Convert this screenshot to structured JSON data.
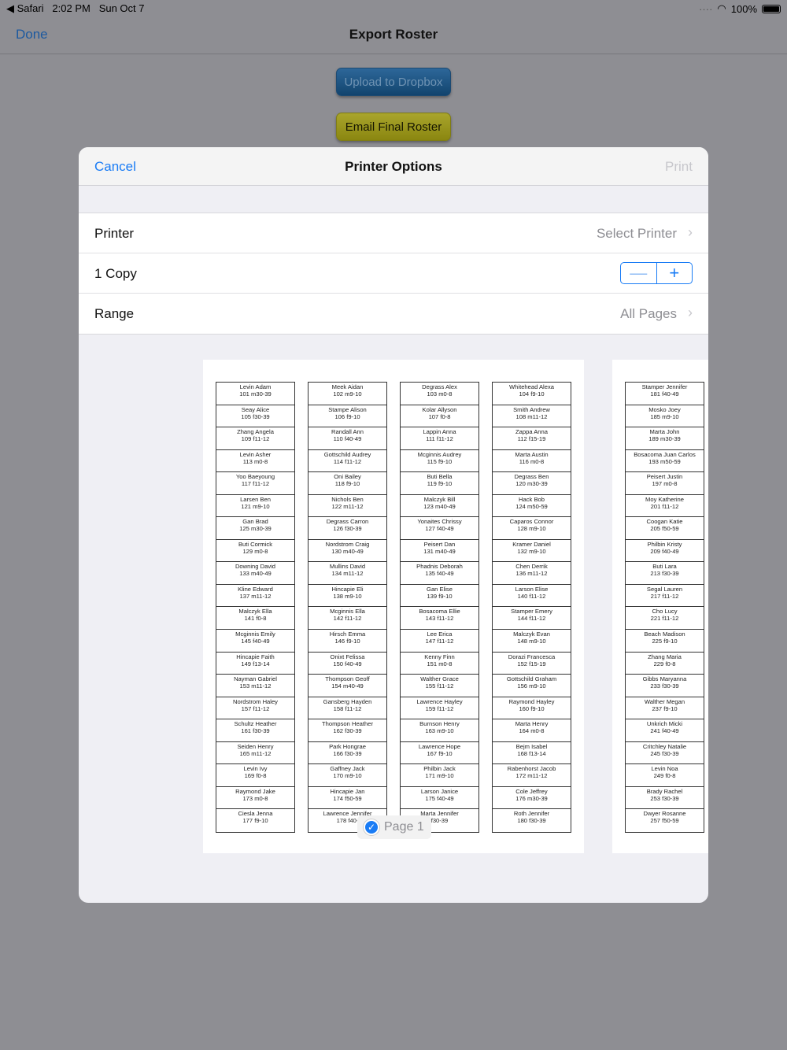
{
  "status": {
    "back_app": "Safari",
    "time": "2:02 PM",
    "date": "Sun Oct 7",
    "battery": "100%",
    "battery_level": 1.0
  },
  "nav": {
    "done": "Done",
    "title": "Export Roster"
  },
  "actions": {
    "upload": "Upload to Dropbox",
    "email": "Email Final Roster"
  },
  "printer_options": {
    "cancel": "Cancel",
    "title": "Printer Options",
    "print": "Print",
    "printer_label": "Printer",
    "printer_value": "Select Printer",
    "copies_label": "1 Copy",
    "copies": 1,
    "range_label": "Range",
    "range_value": "All Pages",
    "page_badge": "Page 1"
  },
  "pages": [
    {
      "columns": [
        {
          "cells": [
            [
              "Levin Adam",
              "101 m30-39"
            ],
            [
              "Seay Alice",
              "105 f30-39"
            ],
            [
              "Zhang Angela",
              "109 f11-12"
            ],
            [
              "Levin Asher",
              "113 m0-8"
            ],
            [
              "Yoo Baeyoung",
              "117 f11-12"
            ],
            [
              "Larsen Ben",
              "121 m9-10"
            ],
            [
              "Gan Brad",
              "125 m30-39"
            ],
            [
              "Buti Cormick",
              "129 m0-8"
            ],
            [
              "Downing David",
              "133 m40-49"
            ],
            [
              "Kline Edward",
              "137 m11-12"
            ],
            [
              "Malczyk Ella",
              "141 f0-8"
            ],
            [
              "Mcginnis Emily",
              "145 f40-49"
            ],
            [
              "Hincapie Faith",
              "149 f13-14"
            ],
            [
              "Nayman Gabriel",
              "153 m11-12"
            ],
            [
              "Nordstrom Haley",
              "157 f11-12"
            ],
            [
              "Schultz Heather",
              "161 f30-39"
            ],
            [
              "Seiden Henry",
              "165 m11-12"
            ],
            [
              "Levin Ivy",
              "169 f0-8"
            ],
            [
              "Raymond Jake",
              "173 m0-8"
            ],
            [
              "Ciesla Jenna",
              "177 f9-10"
            ]
          ]
        },
        {
          "cells": [
            [
              "Meek Aidan",
              "102 m9-10"
            ],
            [
              "Stampe Alison",
              "106 f9-10"
            ],
            [
              "Randall Ann",
              "110 f40-49"
            ],
            [
              "Gottschild Audrey",
              "114 f11-12"
            ],
            [
              "Oni Bailey",
              "118 f9-10"
            ],
            [
              "Nichols Ben",
              "122 m11-12"
            ],
            [
              "Degrass Carron",
              "126 f30-39"
            ],
            [
              "Nordstrom Craig",
              "130 m40-49"
            ],
            [
              "Mullins David",
              "134 m11-12"
            ],
            [
              "Hincapie Eli",
              "138 m9-10"
            ],
            [
              "Mcginnis Ella",
              "142 f11-12"
            ],
            [
              "Hirsch Emma",
              "146 f9-10"
            ],
            [
              "Onixt Felissa",
              "150 f40-49"
            ],
            [
              "Thompson Geoff",
              "154 m40-49"
            ],
            [
              "Gansberg Hayden",
              "158 f11-12"
            ],
            [
              "Thompson Heather",
              "162 f30-39"
            ],
            [
              "Park Hongrae",
              "166 f30-39"
            ],
            [
              "Gaffney Jack",
              "170 m9-10"
            ],
            [
              "Hincapie Jan",
              "174 f50-59"
            ],
            [
              "Lawrence Jennifer",
              "178 f40-"
            ]
          ]
        },
        {
          "cells": [
            [
              "Degrass Alex",
              "103 m0-8"
            ],
            [
              "Kolar Allyson",
              "107 f0-8"
            ],
            [
              "Lappin Anna",
              "111 f11-12"
            ],
            [
              "Mcginnis Audrey",
              "115 f9-10"
            ],
            [
              "Buti Bella",
              "119 f9-10"
            ],
            [
              "Malczyk Bill",
              "123 m40-49"
            ],
            [
              "Yonaites Chrissy",
              "127 f40-49"
            ],
            [
              "Peisert Dan",
              "131 m40-49"
            ],
            [
              "Phadnis Deborah",
              "135 f40-49"
            ],
            [
              "Gan Elise",
              "139 f9-10"
            ],
            [
              "Bosacoma Ellie",
              "143 f11-12"
            ],
            [
              "Lee Erica",
              "147 f11-12"
            ],
            [
              "Kenny Finn",
              "151 m0-8"
            ],
            [
              "Walther Grace",
              "155 f11-12"
            ],
            [
              "Lawrence Hayley",
              "159 f11-12"
            ],
            [
              "Burnson Henry",
              "163 m9-10"
            ],
            [
              "Lawrence Hope",
              "167 f9-10"
            ],
            [
              "Philbin Jack",
              "171 m9-10"
            ],
            [
              "Larson Janice",
              "175 f40-49"
            ],
            [
              "Marta Jennifer",
              "f30-39"
            ]
          ]
        },
        {
          "cells": [
            [
              "Whitehead Alexa",
              "104 f9-10"
            ],
            [
              "Smith Andrew",
              "108 m11-12"
            ],
            [
              "Zappa Anna",
              "112 f15-19"
            ],
            [
              "Marta Austin",
              "116 m0-8"
            ],
            [
              "Degrass Ben",
              "120 m30-39"
            ],
            [
              "Hack Bob",
              "124 m50-59"
            ],
            [
              "Caparos Connor",
              "128 m9-10"
            ],
            [
              "Kramer Daniel",
              "132 m9-10"
            ],
            [
              "Chen Derrik",
              "136 m11-12"
            ],
            [
              "Larson Elise",
              "140 f11-12"
            ],
            [
              "Stamper Emery",
              "144 f11-12"
            ],
            [
              "Malczyk Evan",
              "148 m9-10"
            ],
            [
              "Dorazi Francesca",
              "152 f15-19"
            ],
            [
              "Gottschild Graham",
              "156 m9-10"
            ],
            [
              "Raymond Hayley",
              "160 f9-10"
            ],
            [
              "Marta Henry",
              "164 m0-8"
            ],
            [
              "Bejm Isabel",
              "168 f13-14"
            ],
            [
              "Rabenhorst Jacob",
              "172 m11-12"
            ],
            [
              "Cole Jeffrey",
              "176 m30-39"
            ],
            [
              "Roth Jennifer",
              "180 f30-39"
            ]
          ]
        }
      ]
    },
    {
      "columns": [
        {
          "cells": [
            [
              "Stamper Jennifer",
              "181 f40-49"
            ],
            [
              "Mosko Joey",
              "185 m9-10"
            ],
            [
              "Marta John",
              "189 m30-39"
            ],
            [
              "Bosacoma Juan Carlos",
              "193 m50-59"
            ],
            [
              "Peisert Justin",
              "197 m0-8"
            ],
            [
              "Moy Katherine",
              "201 f11-12"
            ],
            [
              "Coogan Katie",
              "205 f50-59"
            ],
            [
              "Philbin Kristy",
              "209 f40-49"
            ],
            [
              "Buti Lara",
              "213 f30-39"
            ],
            [
              "Segal Lauren",
              "217 f11-12"
            ],
            [
              "Cho Lucy",
              "221 f11-12"
            ],
            [
              "Beach Madison",
              "225 f9-10"
            ],
            [
              "Zhang Maria",
              "229 f0-8"
            ],
            [
              "Gibbs Maryanna",
              "233 f30-39"
            ],
            [
              "Walther Megan",
              "237 f9-10"
            ],
            [
              "Unkrich Micki",
              "241 f40-49"
            ],
            [
              "Critchley Natalie",
              "245 f30-39"
            ],
            [
              "Levin Noa",
              "249 f0-8"
            ],
            [
              "Brady Rachel",
              "253 f30-39"
            ],
            [
              "Dwyer Rosanne",
              "257 f50-59"
            ]
          ]
        }
      ]
    }
  ]
}
